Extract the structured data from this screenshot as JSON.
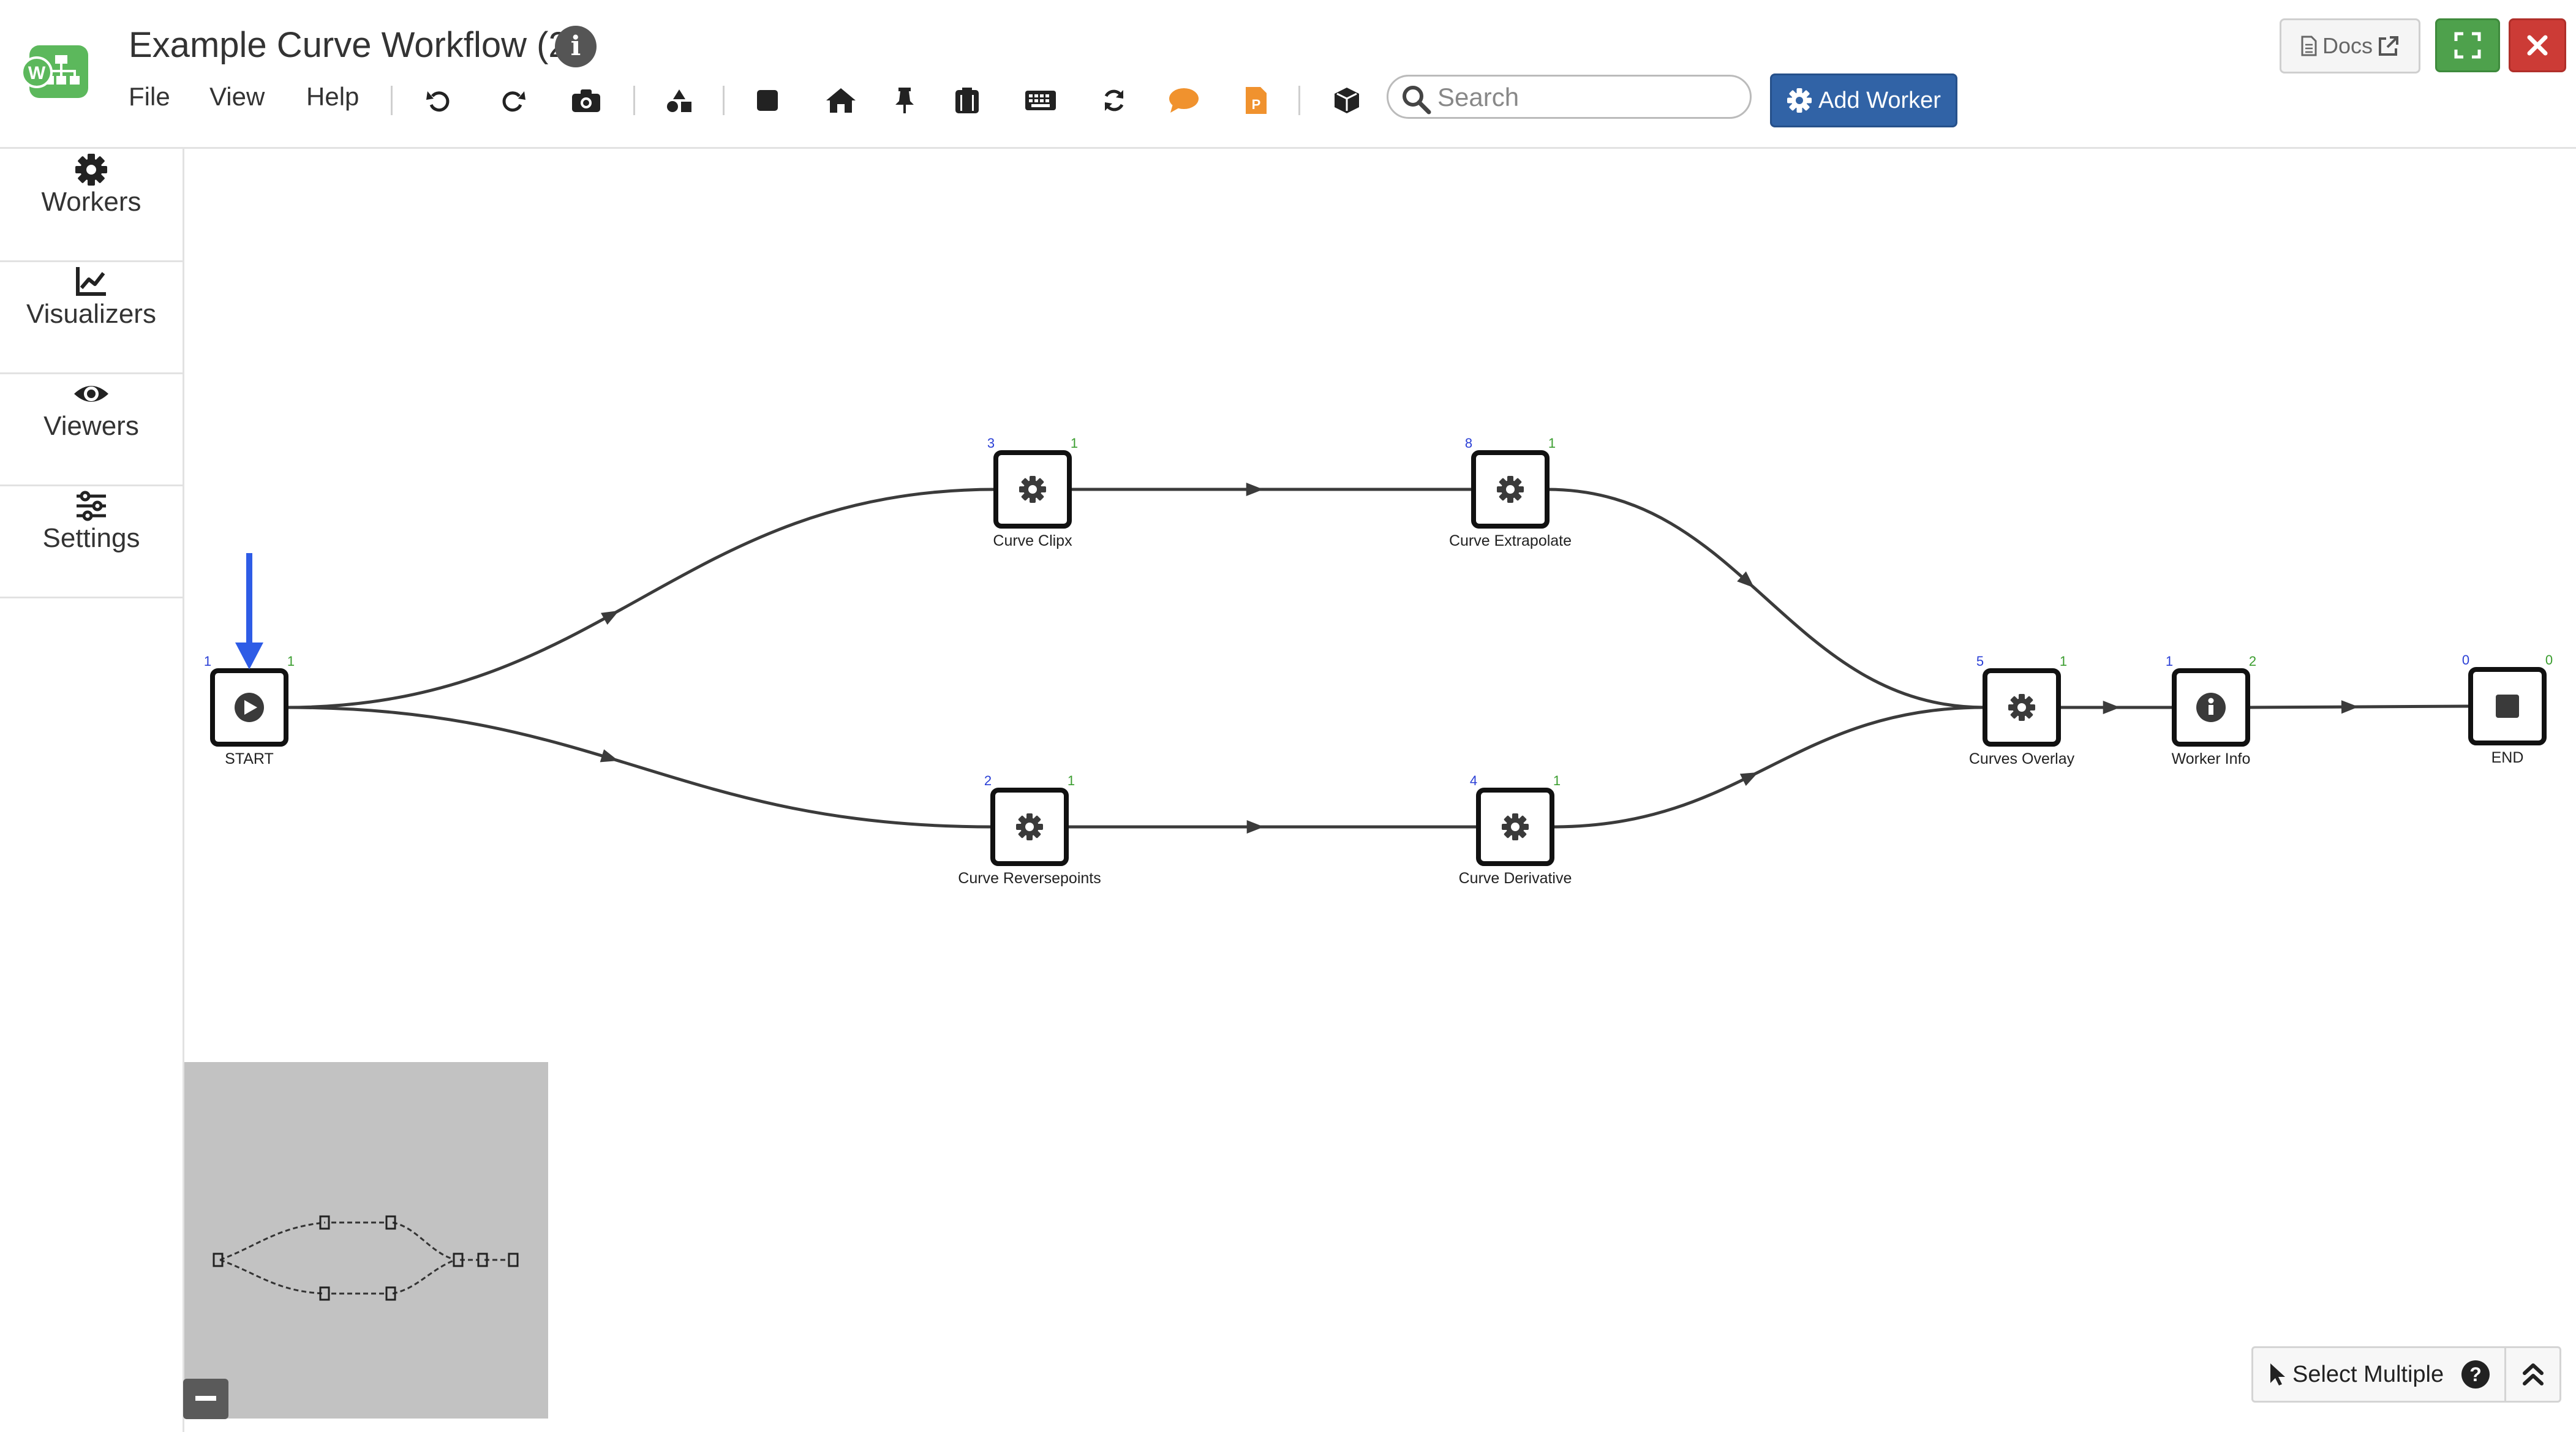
{
  "header": {
    "title": "Example Curve Workflow (2)",
    "logo_letter": "W",
    "menu": [
      "File",
      "View",
      "Help"
    ],
    "toolbar_icons": [
      "undo-icon",
      "redo-icon",
      "camera-icon",
      "shapes-icon",
      "stop-icon",
      "home-icon",
      "pin-icon",
      "clipboard-icon",
      "keyboard-icon",
      "refresh-icon",
      "comment-icon",
      "pdf-file-icon",
      "cube-icon"
    ],
    "search_placeholder": "Search",
    "add_worker_label": "Add Worker",
    "docs_label": "Docs"
  },
  "sidebar": {
    "items": [
      {
        "label": "Workers",
        "icon": "gear-icon"
      },
      {
        "label": "Visualizers",
        "icon": "line-chart-icon"
      },
      {
        "label": "Viewers",
        "icon": "eye-icon"
      },
      {
        "label": "Settings",
        "icon": "sliders-icon"
      }
    ]
  },
  "graph": {
    "nodes": [
      {
        "id": "start",
        "label": "START",
        "icon": "play-icon",
        "in": "1",
        "out": "1"
      },
      {
        "id": "clipx",
        "label": "Curve Clipx",
        "icon": "gear-icon",
        "in": "3",
        "out": "1"
      },
      {
        "id": "extrap",
        "label": "Curve Extrapolate",
        "icon": "gear-icon",
        "in": "8",
        "out": "1"
      },
      {
        "id": "revpts",
        "label": "Curve Reversepoints",
        "icon": "gear-icon",
        "in": "2",
        "out": "1"
      },
      {
        "id": "deriv",
        "label": "Curve Derivative",
        "icon": "gear-icon",
        "in": "4",
        "out": "1"
      },
      {
        "id": "overlay",
        "label": "Curves Overlay",
        "icon": "gear-icon",
        "in": "5",
        "out": "1"
      },
      {
        "id": "info",
        "label": "Worker Info",
        "icon": "info-icon",
        "in": "1",
        "out": "2"
      },
      {
        "id": "end",
        "label": "END",
        "icon": "stop-icon",
        "in": "0",
        "out": "0"
      }
    ],
    "edges": [
      [
        "start",
        "clipx"
      ],
      [
        "start",
        "revpts"
      ],
      [
        "clipx",
        "extrap"
      ],
      [
        "revpts",
        "deriv"
      ],
      [
        "extrap",
        "overlay"
      ],
      [
        "deriv",
        "overlay"
      ],
      [
        "overlay",
        "info"
      ],
      [
        "info",
        "end"
      ]
    ]
  },
  "footer": {
    "select_multiple_label": "Select Multiple"
  },
  "colors": {
    "add_worker": "#3163a6",
    "fullscreen": "#4ea14c",
    "close": "#cc3b36",
    "port_in": "#2a3fd6",
    "port_out": "#3a9d2e",
    "annotation_arrow": "#2e5ce6",
    "minimap_bg": "#c2c2c2"
  }
}
